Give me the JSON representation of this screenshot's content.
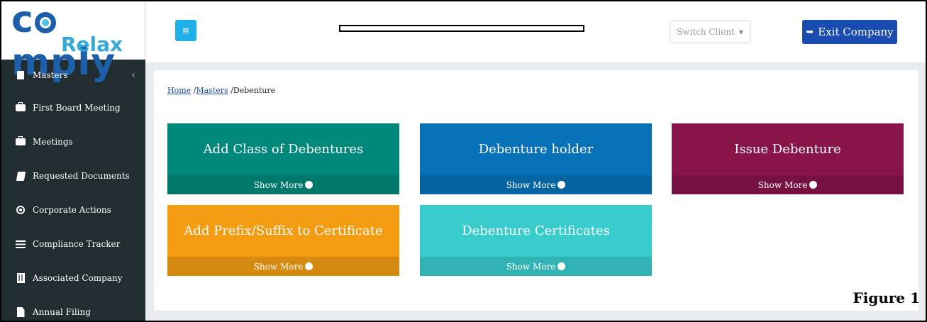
{
  "logo": {
    "main_left": "c",
    "main_right": "mply",
    "sub": "Relax"
  },
  "sidebar": {
    "items": [
      {
        "label": "Masters",
        "icon": "building-icon"
      },
      {
        "label": "First Board Meeting",
        "icon": "briefcase-icon"
      },
      {
        "label": "Meetings",
        "icon": "briefcase-icon"
      },
      {
        "label": "Requested Documents",
        "icon": "book-icon"
      },
      {
        "label": "Corporate Actions",
        "icon": "target-icon"
      },
      {
        "label": "Compliance Tracker",
        "icon": "list-icon"
      },
      {
        "label": "Associated Company",
        "icon": "office-icon"
      },
      {
        "label": "Annual Filing",
        "icon": "file-icon"
      }
    ]
  },
  "header": {
    "switch_client": "Switch Client",
    "exit_label": "Exit Company"
  },
  "breadcrumb": {
    "home": "Home",
    "sep1": " /",
    "masters": "Masters",
    "sep2": " /",
    "current": "Debenture"
  },
  "cards": [
    {
      "title": "Add Class of Debentures",
      "more": "Show More",
      "color": "#00897b"
    },
    {
      "title": "Debenture holder",
      "more": "Show More",
      "color": "#0772b8"
    },
    {
      "title": "Issue Debenture",
      "more": "Show More",
      "color": "#88144a"
    },
    {
      "title": "Add Prefix/Suffix to Certificate",
      "more": "Show More",
      "color": "#f39c12"
    },
    {
      "title": "Debenture Certificates",
      "more": "Show More",
      "color": "#39cccc"
    }
  ],
  "caption": "Figure 1"
}
